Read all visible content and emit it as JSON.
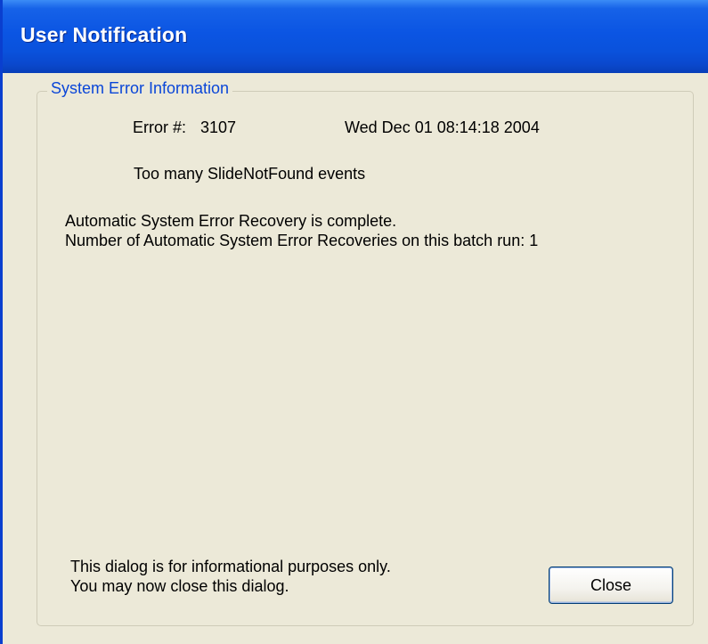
{
  "window": {
    "title": "User Notification"
  },
  "group": {
    "legend": "System Error Information"
  },
  "error": {
    "number_label": "Error #:",
    "number": "3107",
    "timestamp": "Wed Dec 01 08:14:18 2004",
    "message": "Too many SlideNotFound events"
  },
  "recovery": {
    "line1": "Automatic System Error Recovery is complete.",
    "line2": "Number of Automatic System Error Recoveries on this batch run: 1"
  },
  "footer": {
    "info_line1": "This dialog is for informational purposes only.",
    "info_line2": "You may now close this dialog."
  },
  "buttons": {
    "close_label": "Close"
  },
  "colors": {
    "titlebar": "#0a52dc",
    "legend_text": "#0a46d8",
    "dialog_background": "#ece9d8"
  }
}
